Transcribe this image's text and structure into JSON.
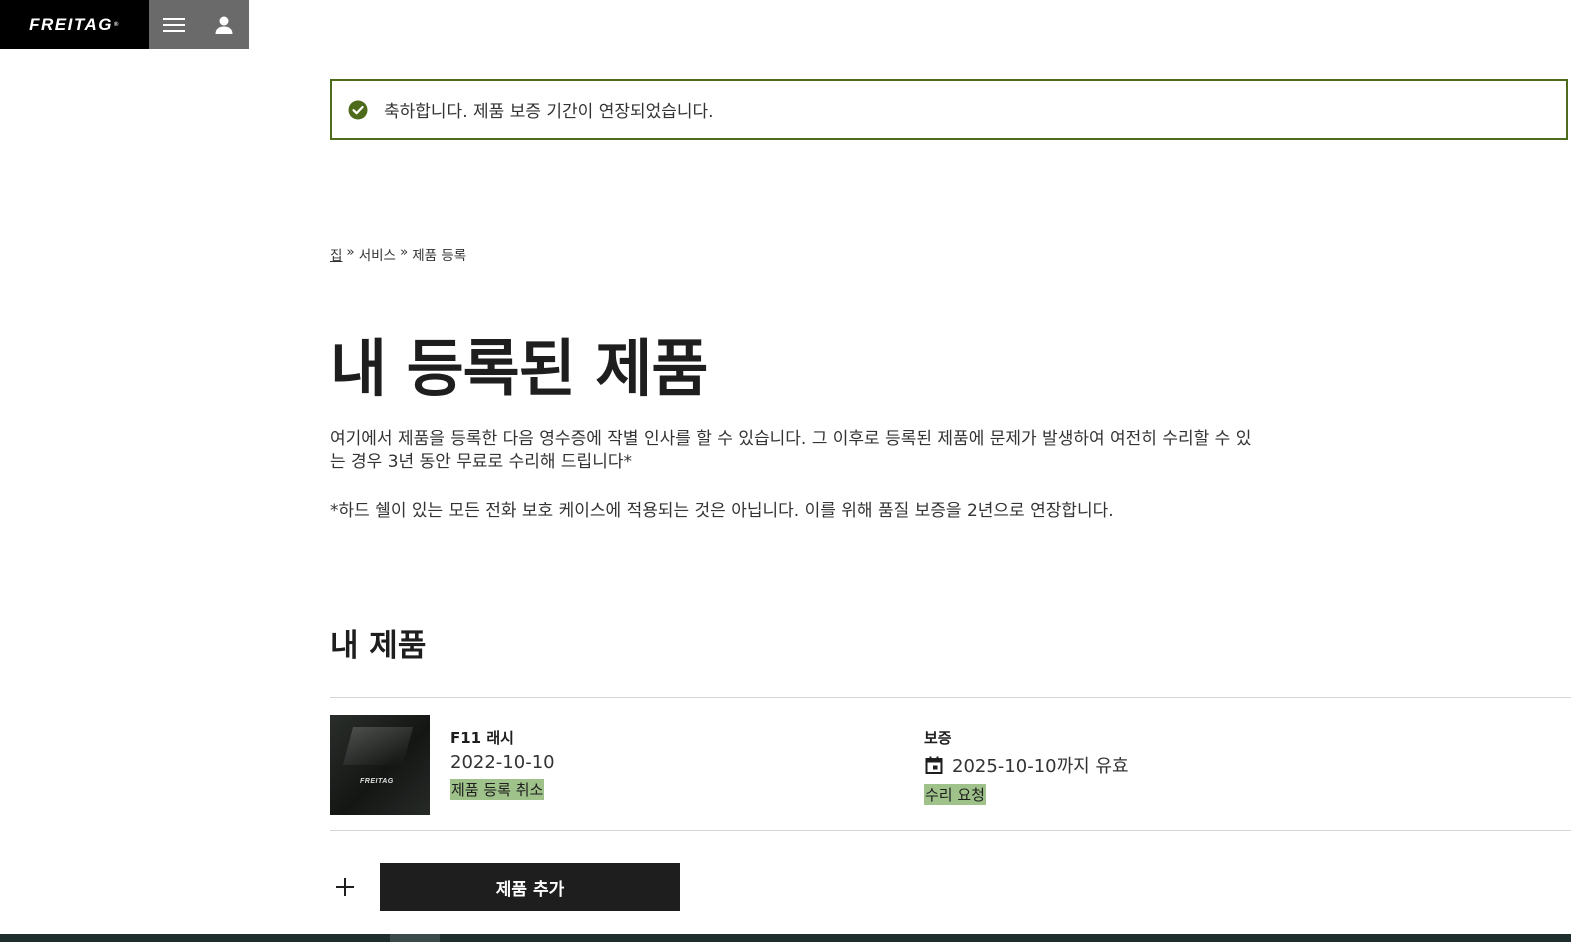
{
  "header": {
    "logo_text": "FREITAG",
    "logo_mark": "®",
    "menu_icon": "hamburger-menu-icon",
    "account_icon": "user-icon"
  },
  "alert": {
    "icon": "check-circle-icon",
    "message": "축하합니다. 제품 보증 기간이 연장되었습니다.",
    "color": "#4e6b1c"
  },
  "breadcrumb": {
    "items": [
      "집",
      "서비스",
      "제품 등록"
    ],
    "separator": "»"
  },
  "page_title": "내 등록된 제품",
  "intro": {
    "text": "여기에서 제품을 등록한 다음 영수증에 작별 인사를 할 수 있습니다. 그 이후로 등록된 제품에 문제가 발생하여 여전히 수리할 수 있는 경우 3년 동안 무료로 수리해 드립니다*",
    "note": "*하드 쉘이 있는 모든 전화 보호 케이스에 적용되는 것은 아닙니다. 이를 위해 품질 보증을 2년으로 연장합니다."
  },
  "my_products": {
    "title": "내 제품",
    "items": [
      {
        "name": "F11 래시",
        "date": "2022-10-10",
        "unregister_label": "제품 등록 취소",
        "warranty_label": "보증",
        "warranty_valid": "2025-10-10까지 유효",
        "warranty_icon": "calendar-icon",
        "repair_label": "수리 요청",
        "thumbnail_logo": "FREITAG"
      }
    ],
    "add_button_label": "제품 추가",
    "add_icon": "plus-icon"
  },
  "colors": {
    "highlight": "#9fc18a",
    "dark": "#1e1e1e",
    "menu_bg": "#6a6a6a"
  }
}
